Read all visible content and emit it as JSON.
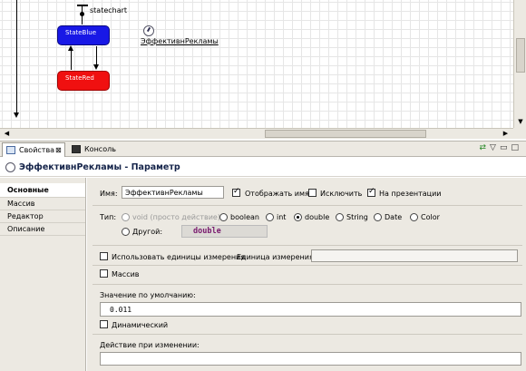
{
  "canvas": {
    "statechart_label": "statechart",
    "state_blue_label": "StateBlue",
    "state_red_label": "StateRed",
    "parameter_label": "ЭффективнРекламы"
  },
  "tabs": {
    "properties": "Свойства",
    "properties_close": "⊠",
    "console": "Консоль"
  },
  "panel": {
    "title": "ЭффективнРекламы - Параметр"
  },
  "nav": {
    "items": [
      {
        "label": "Основные"
      },
      {
        "label": "Массив"
      },
      {
        "label": "Редактор"
      },
      {
        "label": "Описание"
      }
    ]
  },
  "form": {
    "name_label": "Имя:",
    "name_value": "ЭффективнРекламы",
    "show_name_label": "Отображать имя",
    "show_name_checked": true,
    "exclude_label": "Исключить",
    "exclude_checked": false,
    "on_presentation_label": "На презентации",
    "on_presentation_checked": true,
    "type_label": "Тип:",
    "types": [
      {
        "label": "void (просто действие)",
        "selected": false,
        "disabled": true
      },
      {
        "label": "boolean",
        "selected": false
      },
      {
        "label": "int",
        "selected": false
      },
      {
        "label": "double",
        "selected": true
      },
      {
        "label": "String",
        "selected": false
      },
      {
        "label": "Date",
        "selected": false
      },
      {
        "label": "Color",
        "selected": false
      }
    ],
    "other_label": "Другой:",
    "other_value": "double",
    "use_units_label": "Использовать единицы измерения",
    "unit_label": "Единица измерения:",
    "unit_value": "",
    "array_label": "Массив",
    "default_label": "Значение по умолчанию:",
    "default_value": "0.011",
    "dynamic_label": "Динамический",
    "on_change_label": "Действие при изменении:",
    "on_change_value": ""
  }
}
